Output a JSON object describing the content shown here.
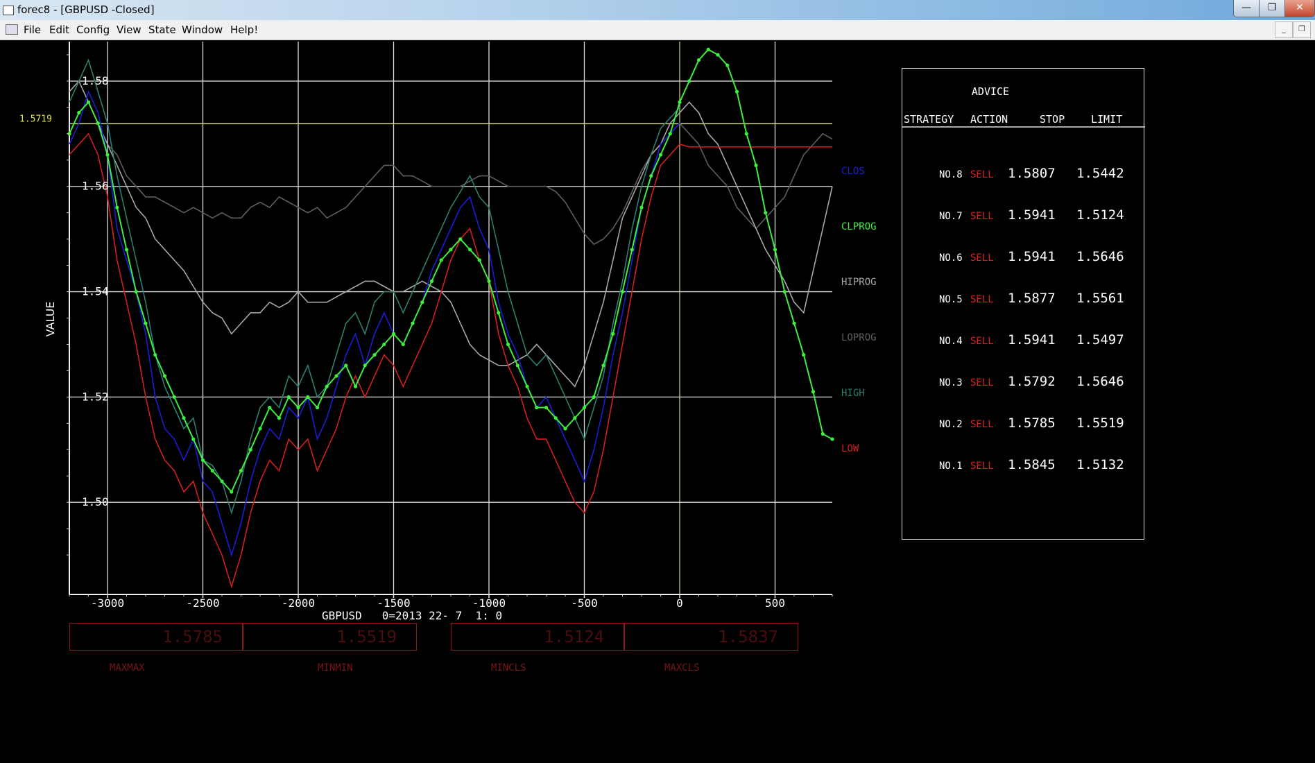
{
  "window": {
    "title": "forec8 - [GBPUSD  -Closed]"
  },
  "menu": [
    "File",
    "Edit",
    "Config",
    "View",
    "State",
    "Window",
    "Help!"
  ],
  "chart": {
    "ylabel": "VALUE",
    "xlabel": "GBPUSD   0=2013 22- 7  1: 0",
    "current_marker": "1.5719",
    "ticks_x": [
      "-3000",
      "-2500",
      "-2000",
      "-1500",
      "-1000",
      "-500",
      "0",
      "500"
    ],
    "ticks_y": [
      "1.58",
      "1.56",
      "1.54",
      "1.52",
      "1.50"
    ],
    "colors": {
      "closing": "#1c1cd8",
      "clprog": "#3cf03c",
      "hiprog": "#a8a8a8",
      "loprog": "#5e5e5e",
      "high": "#2f7d72",
      "low": "#d41e1e"
    }
  },
  "legend": [
    "CLOS",
    "CLPROG",
    "HIPROG",
    "LOPROG",
    "HIGH",
    "LOW"
  ],
  "advice": {
    "title": "ADVICE",
    "headers": [
      "STRATEGY",
      "ACTION",
      "STOP",
      "LIMIT"
    ],
    "rows": [
      {
        "strategy": "NO.8",
        "action": "SELL",
        "stop": "1.5807",
        "limit": "1.5442"
      },
      {
        "strategy": "NO.7",
        "action": "SELL",
        "stop": "1.5941",
        "limit": "1.5124"
      },
      {
        "strategy": "NO.6",
        "action": "SELL",
        "stop": "1.5941",
        "limit": "1.5646"
      },
      {
        "strategy": "NO.5",
        "action": "SELL",
        "stop": "1.5877",
        "limit": "1.5561"
      },
      {
        "strategy": "NO.4",
        "action": "SELL",
        "stop": "1.5941",
        "limit": "1.5497"
      },
      {
        "strategy": "NO.3",
        "action": "SELL",
        "stop": "1.5792",
        "limit": "1.5646"
      },
      {
        "strategy": "NO.2",
        "action": "SELL",
        "stop": "1.5785",
        "limit": "1.5519"
      },
      {
        "strategy": "NO.1",
        "action": "SELL",
        "stop": "1.5845",
        "limit": "1.5132"
      }
    ]
  },
  "stats": [
    {
      "value": "1.5785",
      "label": "MAXMAX"
    },
    {
      "value": "1.5519",
      "label": "MINMIN"
    },
    {
      "value": "1.5124",
      "label": "MINCLS"
    },
    {
      "value": "1.5837",
      "label": "MAXCLS"
    }
  ],
  "chart_data": {
    "type": "line",
    "xlabel": "GBPUSD   0=2013 22- 7  1: 0",
    "ylabel": "VALUE",
    "xlim": [
      -3200,
      800
    ],
    "ylim": [
      1.4825,
      1.5875
    ],
    "grid": true,
    "legend_position": "right",
    "current_level": 1.5719,
    "series": [
      {
        "name": "CLOS",
        "x": [
          -3200,
          -3150,
          -3100,
          -3050,
          -3000,
          -2950,
          -2900,
          -2850,
          -2800,
          -2750,
          -2700,
          -2650,
          -2600,
          -2550,
          -2500,
          -2450,
          -2400,
          -2350,
          -2300,
          -2250,
          -2200,
          -2150,
          -2100,
          -2050,
          -2000,
          -1950,
          -1900,
          -1850,
          -1800,
          -1750,
          -1700,
          -1650,
          -1600,
          -1550,
          -1500,
          -1450,
          -1400,
          -1350,
          -1300,
          -1250,
          -1200,
          -1150,
          -1100,
          -1050,
          -1000,
          -950,
          -900,
          -850,
          -800,
          -750,
          -700,
          -650,
          -600,
          -550,
          -500,
          -450,
          -400,
          -350,
          -300,
          -250,
          -200,
          -150,
          -100,
          -50,
          0
        ],
        "y": [
          1.568,
          1.572,
          1.578,
          1.574,
          1.566,
          1.552,
          1.546,
          1.54,
          1.532,
          1.52,
          1.514,
          1.512,
          1.508,
          1.512,
          1.504,
          1.502,
          1.496,
          1.49,
          1.496,
          1.504,
          1.51,
          1.514,
          1.512,
          1.518,
          1.516,
          1.52,
          1.512,
          1.516,
          1.522,
          1.528,
          1.532,
          1.526,
          1.532,
          1.536,
          1.532,
          1.53,
          1.534,
          1.538,
          1.544,
          1.548,
          1.552,
          1.556,
          1.558,
          1.552,
          1.548,
          1.538,
          1.532,
          1.528,
          1.522,
          1.518,
          1.52,
          1.516,
          1.512,
          1.508,
          1.504,
          1.51,
          1.518,
          1.528,
          1.536,
          1.546,
          1.556,
          1.562,
          1.568,
          1.57,
          1.572
        ]
      },
      {
        "name": "CLPROG",
        "x": [
          -3200,
          -3150,
          -3100,
          -3050,
          -3000,
          -2950,
          -2900,
          -2850,
          -2800,
          -2750,
          -2700,
          -2650,
          -2600,
          -2550,
          -2500,
          -2450,
          -2400,
          -2350,
          -2300,
          -2250,
          -2200,
          -2150,
          -2100,
          -2050,
          -2000,
          -1950,
          -1900,
          -1850,
          -1800,
          -1750,
          -1700,
          -1650,
          -1600,
          -1550,
          -1500,
          -1450,
          -1400,
          -1350,
          -1300,
          -1250,
          -1200,
          -1150,
          -1100,
          -1050,
          -1000,
          -950,
          -900,
          -850,
          -800,
          -750,
          -700,
          -650,
          -600,
          -550,
          -500,
          -450,
          -400,
          -350,
          -300,
          -250,
          -200,
          -150,
          -100,
          -50,
          0,
          50,
          100,
          150,
          200,
          250,
          300,
          350,
          400,
          450,
          500,
          550,
          600,
          650,
          700,
          750,
          800
        ],
        "y": [
          1.57,
          1.574,
          1.576,
          1.572,
          1.566,
          1.556,
          1.548,
          1.54,
          1.534,
          1.528,
          1.524,
          1.52,
          1.516,
          1.512,
          1.508,
          1.506,
          1.504,
          1.502,
          1.506,
          1.51,
          1.514,
          1.518,
          1.516,
          1.52,
          1.518,
          1.52,
          1.518,
          1.522,
          1.524,
          1.526,
          1.522,
          1.526,
          1.528,
          1.53,
          1.532,
          1.53,
          1.534,
          1.538,
          1.542,
          1.546,
          1.548,
          1.55,
          1.548,
          1.546,
          1.542,
          1.536,
          1.53,
          1.526,
          1.522,
          1.518,
          1.518,
          1.516,
          1.514,
          1.516,
          1.518,
          1.52,
          1.526,
          1.532,
          1.54,
          1.548,
          1.556,
          1.562,
          1.566,
          1.57,
          1.576,
          1.58,
          1.584,
          1.586,
          1.585,
          1.583,
          1.578,
          1.57,
          1.564,
          1.555,
          1.548,
          1.54,
          1.534,
          1.528,
          1.521,
          1.513,
          1.512
        ]
      },
      {
        "name": "HIPROG",
        "x": [
          -3200,
          -3150,
          -3100,
          -3050,
          -3000,
          -2950,
          -2900,
          -2850,
          -2800,
          -2750,
          -2700,
          -2650,
          -2600,
          -2550,
          -2500,
          -2450,
          -2400,
          -2350,
          -2300,
          -2250,
          -2200,
          -2150,
          -2100,
          -2050,
          -2000,
          -1950,
          -1900,
          -1850,
          -1800,
          -1750,
          -1700,
          -1650,
          -1600,
          -1550,
          -1500,
          -1450,
          -1400,
          -1350,
          -1300,
          -1250,
          -1200,
          -1150,
          -1100,
          -1050,
          -1000,
          -950,
          -900,
          -850,
          -800,
          -750,
          -700,
          -650,
          -600,
          -550,
          -500,
          -450,
          -400,
          -350,
          -300,
          -250,
          -200,
          -150,
          -100,
          -50,
          0,
          50,
          100,
          150,
          200,
          250,
          300,
          350,
          400,
          450,
          500,
          550,
          600,
          650,
          700,
          750,
          800
        ],
        "y": [
          1.578,
          1.58,
          1.576,
          1.572,
          1.568,
          1.564,
          1.56,
          1.556,
          1.554,
          1.55,
          1.548,
          1.546,
          1.544,
          1.541,
          1.538,
          1.536,
          1.535,
          1.532,
          1.534,
          1.536,
          1.536,
          1.538,
          1.537,
          1.538,
          1.54,
          1.538,
          1.538,
          1.538,
          1.539,
          1.54,
          1.541,
          1.542,
          1.542,
          1.541,
          1.54,
          1.54,
          1.541,
          1.542,
          1.541,
          1.54,
          1.538,
          1.534,
          1.53,
          1.528,
          1.527,
          1.526,
          1.526,
          1.527,
          1.528,
          1.53,
          1.528,
          1.526,
          1.524,
          1.522,
          1.526,
          1.532,
          1.538,
          1.546,
          1.554,
          1.558,
          1.562,
          1.566,
          1.568,
          1.572,
          1.574,
          1.576,
          1.574,
          1.57,
          1.568,
          1.564,
          1.56,
          1.556,
          1.552,
          1.548,
          1.545,
          1.542,
          1.538,
          1.536,
          1.544,
          1.552,
          1.56
        ]
      },
      {
        "name": "LOPROG",
        "x": [
          -3000,
          -2950,
          -2900,
          -2850,
          -2800,
          -2750,
          -2700,
          -2650,
          -2600,
          -2550,
          -2500,
          -2450,
          -2400,
          -2350,
          -2300,
          -2250,
          -2200,
          -2150,
          -2100,
          -2050,
          -2000,
          -1950,
          -1900,
          -1850,
          -1800,
          -1750,
          -1700,
          -1650,
          -1600,
          -1550,
          -1500,
          -1450,
          -1400,
          -1350,
          -1300,
          -1250,
          -1200,
          -1150,
          -1100,
          -1050,
          -1000,
          -950,
          -900,
          -850,
          -800,
          -750,
          -700,
          -650,
          -600,
          -550,
          -500,
          -450,
          -400,
          -350,
          -300,
          -250,
          -200,
          -150,
          -100,
          -50,
          0,
          50,
          100,
          150,
          200,
          250,
          300,
          350,
          400,
          450,
          500,
          550,
          600,
          650,
          700,
          750,
          800
        ],
        "y": [
          1.568,
          1.566,
          1.562,
          1.56,
          1.558,
          1.558,
          1.557,
          1.556,
          1.555,
          1.556,
          1.555,
          1.554,
          1.555,
          1.554,
          1.554,
          1.556,
          1.557,
          1.556,
          1.558,
          1.557,
          1.556,
          1.555,
          1.556,
          1.554,
          1.555,
          1.556,
          1.558,
          1.56,
          1.562,
          1.564,
          1.564,
          1.562,
          1.562,
          1.561,
          1.56,
          1.56,
          1.56,
          1.56,
          1.561,
          1.562,
          1.562,
          1.561,
          1.56,
          1.56,
          1.56,
          1.56,
          1.56,
          1.559,
          1.557,
          1.554,
          1.551,
          1.549,
          1.55,
          1.552,
          1.555,
          1.559,
          1.563,
          1.566,
          1.568,
          1.57,
          1.572,
          1.57,
          1.568,
          1.564,
          1.562,
          1.56,
          1.556,
          1.554,
          1.552,
          1.554,
          1.556,
          1.558,
          1.562,
          1.566,
          1.568,
          1.57,
          1.569
        ]
      },
      {
        "name": "HIGH",
        "x": [
          -3200,
          -3150,
          -3100,
          -3050,
          -3000,
          -2950,
          -2900,
          -2850,
          -2800,
          -2750,
          -2700,
          -2650,
          -2600,
          -2550,
          -2500,
          -2450,
          -2400,
          -2350,
          -2300,
          -2250,
          -2200,
          -2150,
          -2100,
          -2050,
          -2000,
          -1950,
          -1900,
          -1850,
          -1800,
          -1750,
          -1700,
          -1650,
          -1600,
          -1550,
          -1500,
          -1450,
          -1400,
          -1350,
          -1300,
          -1250,
          -1200,
          -1150,
          -1100,
          -1050,
          -1000,
          -950,
          -900,
          -850,
          -800,
          -750,
          -700,
          -650,
          -600,
          -550,
          -500,
          -450,
          -400,
          -350,
          -300,
          -250,
          -200,
          -150,
          -100,
          -50,
          0
        ],
        "y": [
          1.576,
          1.58,
          1.584,
          1.578,
          1.572,
          1.562,
          1.554,
          1.546,
          1.538,
          1.528,
          1.522,
          1.518,
          1.514,
          1.516,
          1.508,
          1.507,
          1.504,
          1.498,
          1.504,
          1.512,
          1.518,
          1.52,
          1.518,
          1.524,
          1.522,
          1.526,
          1.52,
          1.522,
          1.528,
          1.534,
          1.536,
          1.532,
          1.538,
          1.54,
          1.54,
          1.536,
          1.54,
          1.544,
          1.548,
          1.552,
          1.556,
          1.559,
          1.562,
          1.558,
          1.556,
          1.548,
          1.54,
          1.534,
          1.528,
          1.526,
          1.528,
          1.524,
          1.52,
          1.516,
          1.512,
          1.518,
          1.524,
          1.534,
          1.542,
          1.552,
          1.56,
          1.566,
          1.571,
          1.573,
          1.575
        ]
      },
      {
        "name": "LOW",
        "x": [
          -3200,
          -3150,
          -3100,
          -3050,
          -3000,
          -2950,
          -2900,
          -2850,
          -2800,
          -2750,
          -2700,
          -2650,
          -2600,
          -2550,
          -2500,
          -2450,
          -2400,
          -2350,
          -2300,
          -2250,
          -2200,
          -2150,
          -2100,
          -2050,
          -2000,
          -1950,
          -1900,
          -1850,
          -1800,
          -1750,
          -1700,
          -1650,
          -1600,
          -1550,
          -1500,
          -1450,
          -1400,
          -1350,
          -1300,
          -1250,
          -1200,
          -1150,
          -1100,
          -1050,
          -1000,
          -950,
          -900,
          -850,
          -800,
          -750,
          -700,
          -650,
          -600,
          -550,
          -500,
          -450,
          -400,
          -350,
          -300,
          -250,
          -200,
          -150,
          -100,
          -50,
          0,
          50,
          100,
          150,
          200,
          250,
          300,
          350,
          400,
          450,
          500,
          550,
          600,
          650,
          700,
          750,
          800
        ],
        "y": [
          1.566,
          1.568,
          1.57,
          1.566,
          1.558,
          1.546,
          1.538,
          1.53,
          1.52,
          1.512,
          1.508,
          1.506,
          1.502,
          1.504,
          1.498,
          1.494,
          1.49,
          1.484,
          1.49,
          1.498,
          1.504,
          1.508,
          1.506,
          1.512,
          1.51,
          1.512,
          1.506,
          1.51,
          1.514,
          1.52,
          1.524,
          1.52,
          1.524,
          1.528,
          1.526,
          1.522,
          1.526,
          1.53,
          1.534,
          1.54,
          1.546,
          1.55,
          1.552,
          1.546,
          1.542,
          1.532,
          1.526,
          1.522,
          1.516,
          1.512,
          1.512,
          1.508,
          1.504,
          1.5,
          1.498,
          1.502,
          1.51,
          1.52,
          1.53,
          1.54,
          1.55,
          1.558,
          1.564,
          1.566,
          1.568,
          1.5675,
          1.5675,
          1.5675,
          1.5675,
          1.5675,
          1.5675,
          1.5675,
          1.5675,
          1.5675,
          1.5675,
          1.5675,
          1.5675,
          1.5675,
          1.5675,
          1.5675,
          1.5675
        ]
      }
    ]
  }
}
